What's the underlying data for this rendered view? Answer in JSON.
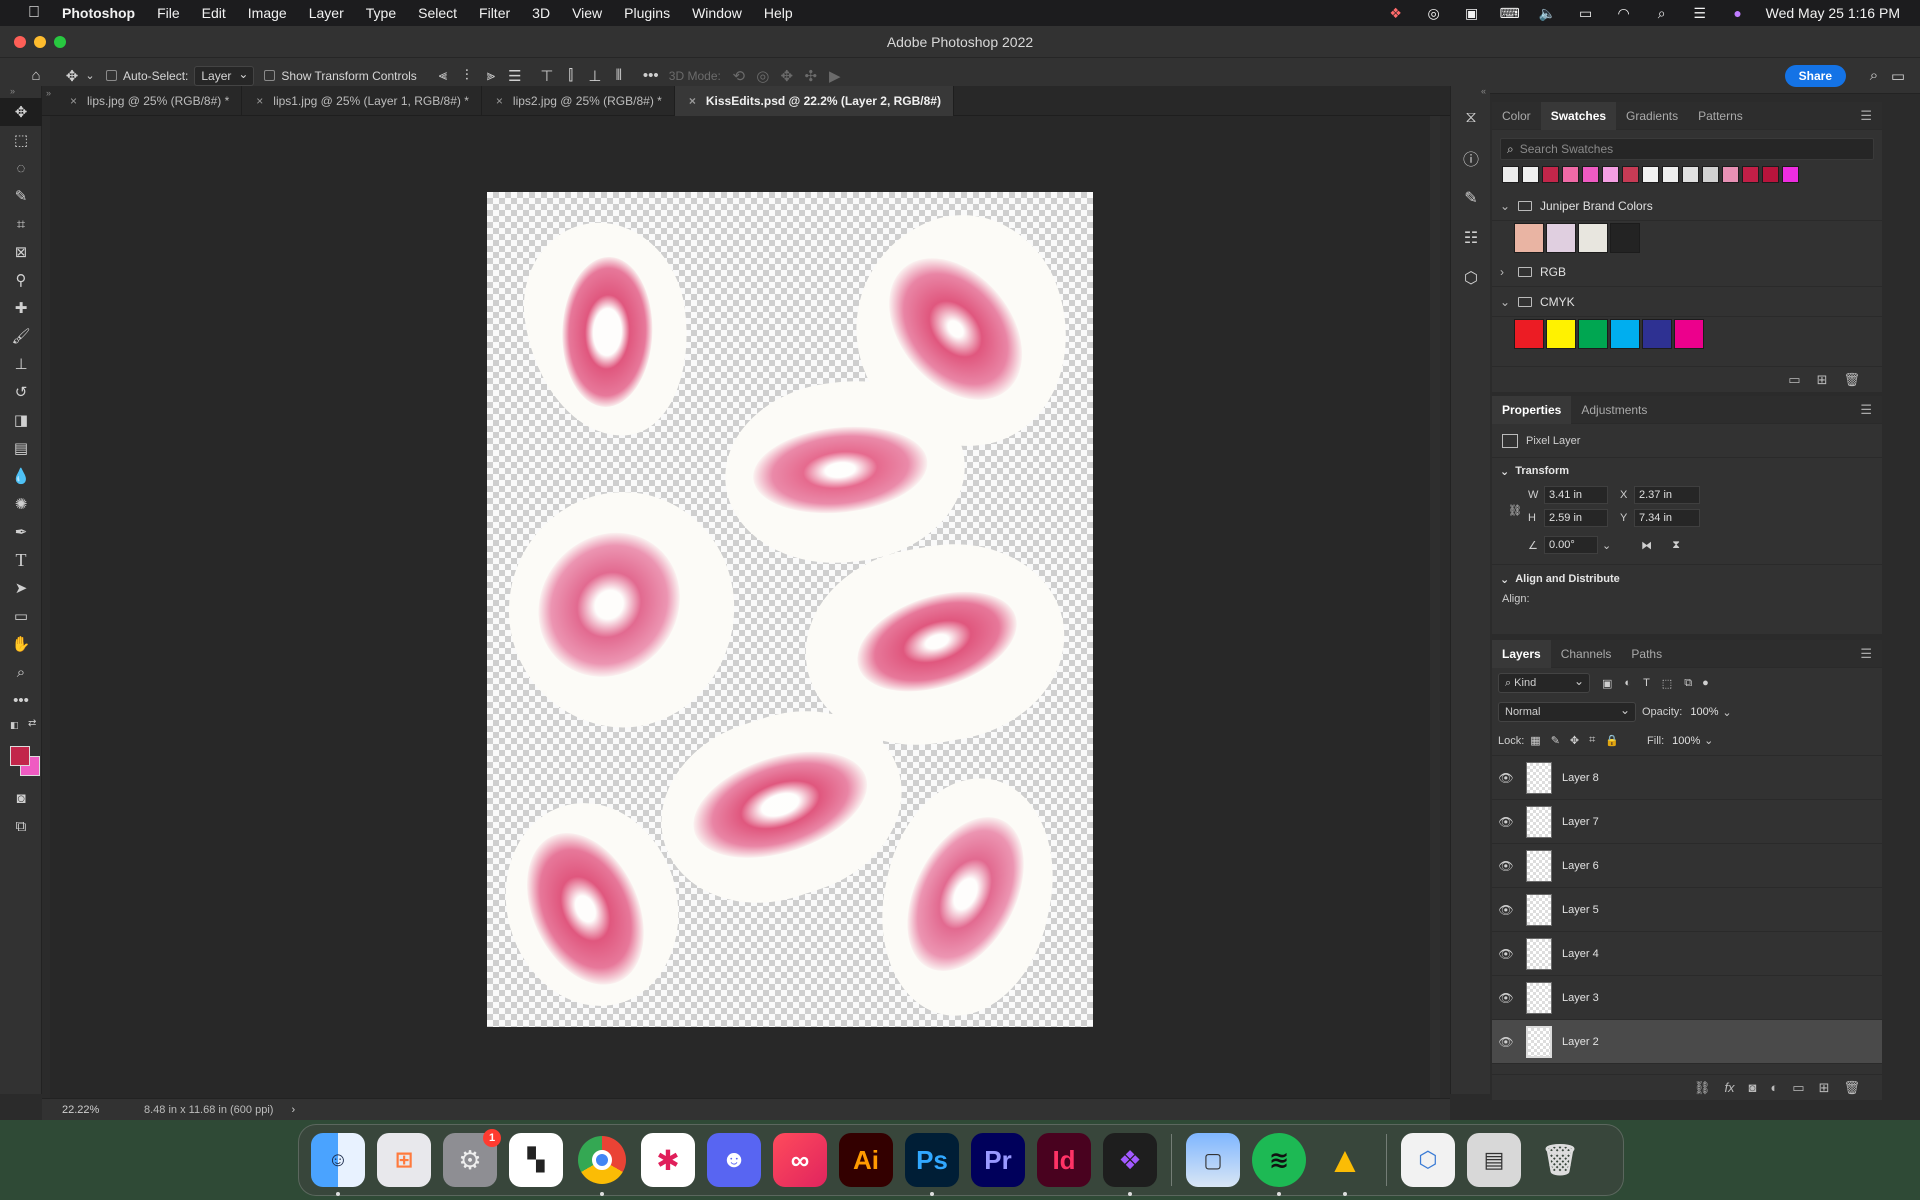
{
  "menubar": {
    "app": "Photoshop",
    "items": [
      "File",
      "Edit",
      "Image",
      "Layer",
      "Type",
      "Select",
      "Filter",
      "3D",
      "View",
      "Plugins",
      "Window",
      "Help"
    ],
    "clock": "Wed May 25  1:16 PM"
  },
  "window": {
    "title": "Adobe Photoshop 2022"
  },
  "options": {
    "auto_select_label": "Auto-Select:",
    "auto_select_value": "Layer",
    "show_transform_label": "Show Transform Controls",
    "mode_3d_label": "3D Mode:",
    "share_label": "Share"
  },
  "tabs": [
    {
      "label": "lips.jpg @ 25% (RGB/8#) *"
    },
    {
      "label": "lips1.jpg @ 25% (Layer 1, RGB/8#) *"
    },
    {
      "label": "lips2.jpg @ 25% (RGB/8#) *"
    },
    {
      "label": "KissEdits.psd @ 22.2% (Layer 2, RGB/8#)"
    }
  ],
  "status": {
    "zoom": "22.22%",
    "doc_size": "8.48 in x 11.68 in (600 ppi)",
    "arrow": "›"
  },
  "swatches_panel": {
    "tabs": [
      "Color",
      "Swatches",
      "Gradients",
      "Patterns"
    ],
    "search_placeholder": "Search Swatches",
    "recent": [
      "#ececec",
      "#f0f0f0",
      "#c2264a",
      "#f06aa6",
      "#ef5bc2",
      "#f59fe3",
      "#c73b55",
      "#f2f2f2",
      "#eeeeee",
      "#e0e0e0",
      "#d2d2d2",
      "#e891b5",
      "#c21f47",
      "#b8143c",
      "#ee2de0"
    ],
    "groups": [
      {
        "name": "Juniper Brand Colors",
        "expanded": true,
        "colors": [
          "#e9b4a3",
          "#e0cfe0",
          "#e8e6df",
          "#232323"
        ]
      },
      {
        "name": "RGB",
        "expanded": false,
        "colors": []
      },
      {
        "name": "CMYK",
        "expanded": true,
        "colors": [
          "#ec1c24",
          "#fff200",
          "#00a651",
          "#00aeef",
          "#2e3192",
          "#ec008c"
        ]
      }
    ]
  },
  "properties_panel": {
    "tabs": [
      "Properties",
      "Adjustments"
    ],
    "layer_type": "Pixel Layer",
    "transform_label": "Transform",
    "w_label": "W",
    "w": "3.41 in",
    "x_label": "X",
    "x": "2.37 in",
    "h_label": "H",
    "h": "2.59 in",
    "y_label": "Y",
    "y": "7.34 in",
    "angle": "0.00°",
    "align_label": "Align and Distribute",
    "align_sub": "Align:"
  },
  "layers_panel": {
    "tabs": [
      "Layers",
      "Channels",
      "Paths"
    ],
    "kind": "Kind",
    "blend": "Normal",
    "opacity_label": "Opacity:",
    "opacity": "100%",
    "lock_label": "Lock:",
    "fill_label": "Fill:",
    "fill": "100%",
    "layers": [
      {
        "name": "Layer 8",
        "selected": false
      },
      {
        "name": "Layer 7",
        "selected": false
      },
      {
        "name": "Layer 6",
        "selected": false
      },
      {
        "name": "Layer 5",
        "selected": false
      },
      {
        "name": "Layer 4",
        "selected": false
      },
      {
        "name": "Layer 3",
        "selected": false
      },
      {
        "name": "Layer 2",
        "selected": true
      }
    ]
  },
  "dock": {
    "finder_icon": "finder-icon",
    "sys_prefs_badge": "1",
    "illustrator": "Ai",
    "photoshop": "Ps",
    "premiere": "Pr",
    "indesign": "Id"
  },
  "colors": {
    "foreground": "#c2264a",
    "background": "#ef5bc2",
    "accent": "#1473e6"
  }
}
